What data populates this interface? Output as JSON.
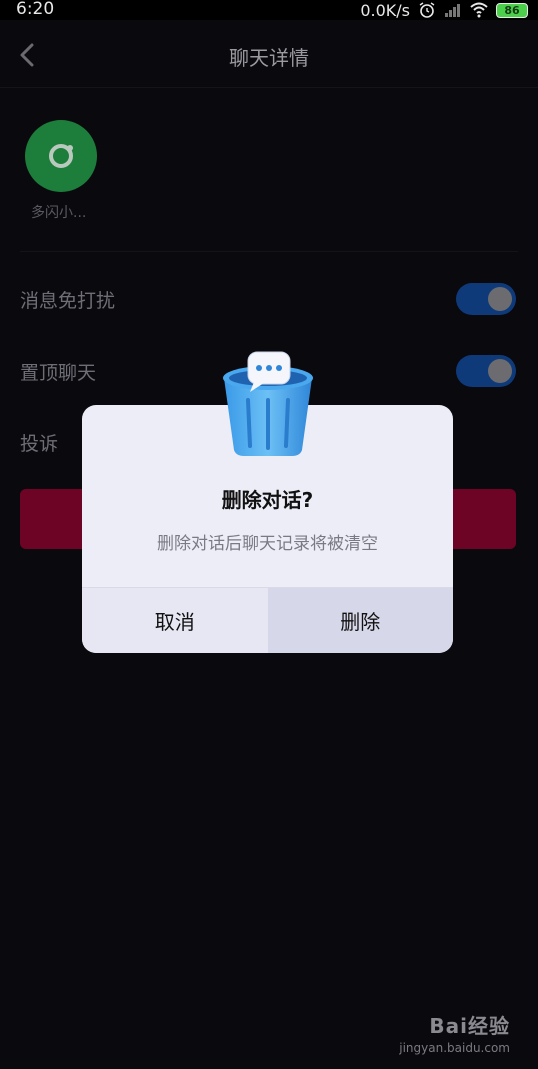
{
  "status_bar": {
    "time": "6:20",
    "net_speed": "0.0K/s",
    "battery": "86",
    "icons": [
      "alarm-icon",
      "signal-icon",
      "wifi-icon",
      "battery-icon"
    ]
  },
  "header": {
    "title": "聊天详情",
    "back_icon": "chevron-left-icon"
  },
  "member": {
    "name": "多闪小...",
    "avatar_color": "#1d7e3c"
  },
  "settings": [
    {
      "label": "消息免打扰",
      "toggle_on": true
    },
    {
      "label": "置顶聊天",
      "toggle_on": true
    },
    {
      "label": "投诉"
    }
  ],
  "dialog": {
    "icon": "trash-chat-icon",
    "title": "删除对话?",
    "message": "删除对话后聊天记录将被清空",
    "cancel_label": "取消",
    "delete_label": "删除"
  },
  "colors": {
    "toggle_on": "#0f3a7a",
    "danger": "#6d0425",
    "background": "#0a090e"
  },
  "watermark": {
    "logo": "Bai经验",
    "url": "jingyan.baidu.com"
  }
}
